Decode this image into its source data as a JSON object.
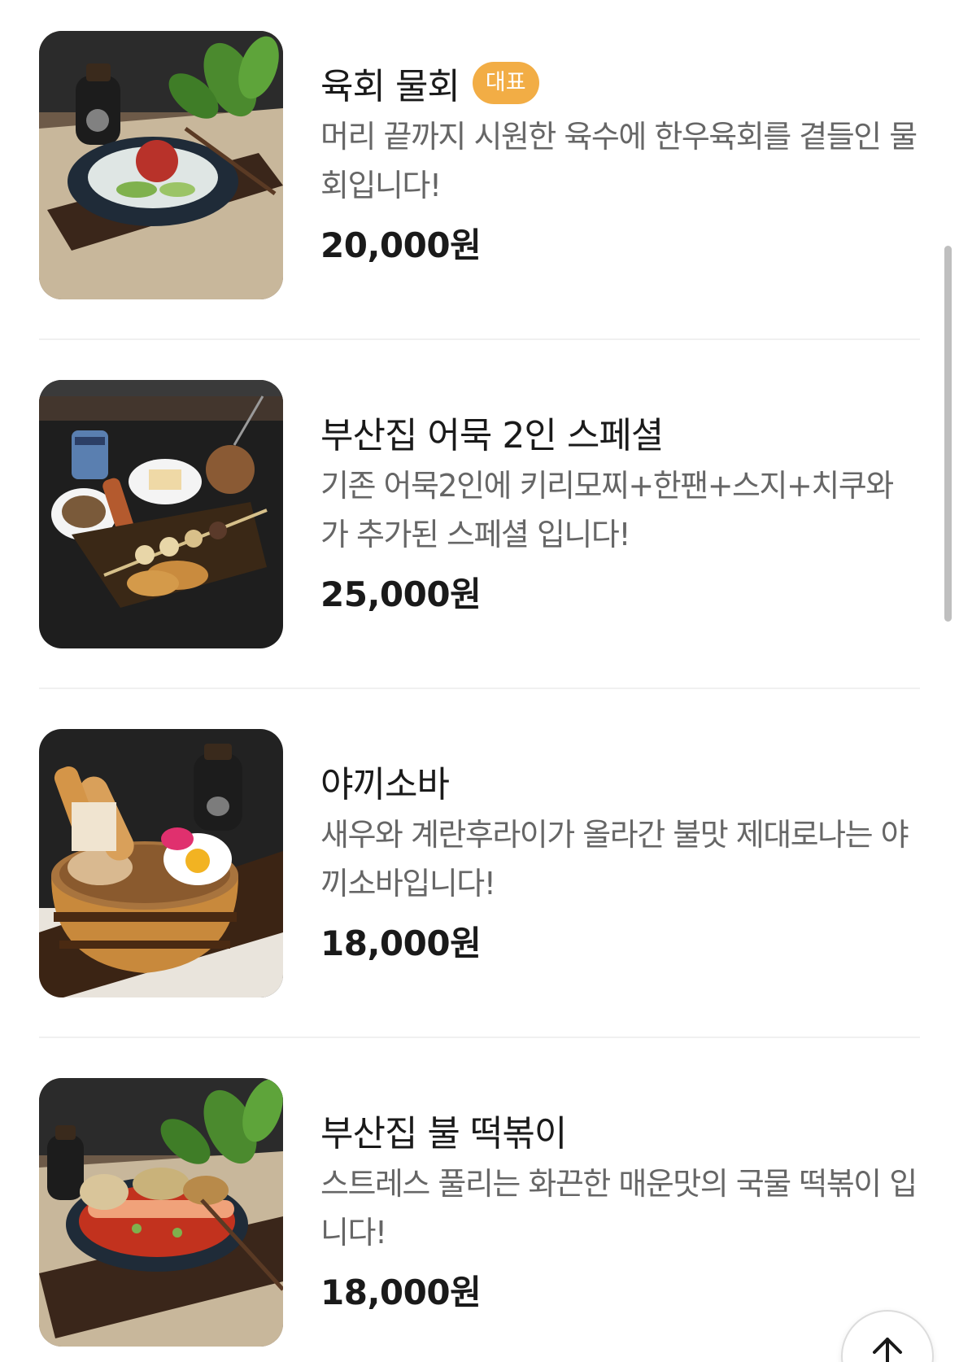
{
  "menu": {
    "items": [
      {
        "name": "육회 물회",
        "badge": "대표",
        "description": "머리 끝까지 시원한 육수에 한우육회를 곁들인 물회입니다!",
        "price": "20,000원",
        "image_icon": "yukhoe-mulhoe-photo"
      },
      {
        "name": "부산집 어묵 2인 스페셜",
        "description": "기존 어묵2인에 키리모찌+한팬+스지+치쿠와 가 추가된 스페셜 입니다!",
        "price": "25,000원",
        "image_icon": "eomuk-special-photo"
      },
      {
        "name": "야끼소바",
        "description": "새우와 계란후라이가 올라간 불맛 제대로나는 야끼소바입니다!",
        "price": "18,000원",
        "image_icon": "yakisoba-photo"
      },
      {
        "name": "부산집 불 떡볶이",
        "description": "스트레스 풀리는 화끈한 매운맛의 국물 떡볶이 입니다!",
        "price": "18,000원",
        "image_icon": "tteokbokki-photo"
      }
    ]
  },
  "scroll_top_button": {
    "icon": "arrow-up-icon"
  },
  "colors": {
    "badge": "#f2ad45",
    "title": "#1a1a1a",
    "description": "#666666",
    "divider": "#f0f0f0"
  }
}
